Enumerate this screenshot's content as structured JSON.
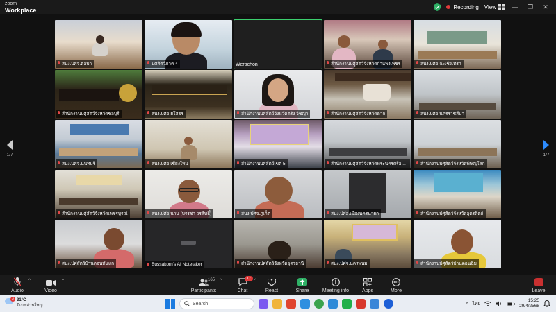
{
  "window": {
    "brand_top": "zoom",
    "brand_bottom": "Workplace",
    "recording_label": "Recording",
    "view_label": "View",
    "view_icon": "grid-icon",
    "controls": [
      "minimize",
      "maximize",
      "close"
    ]
  },
  "gallery": {
    "page_left": "1/7",
    "page_right": "1/7",
    "tiles": [
      {
        "name": "สนง.ปศจ.ตอบา",
        "plain": false
      },
      {
        "name": "ปศสัตว์ภาค 4",
        "plain": false
      },
      {
        "name": "Werachon",
        "plain": true
      },
      {
        "name": "สำนักงานปศุสัตว์จังหวัดกำแพงเพชร",
        "plain": false
      },
      {
        "name": "สนง.ปศจ.ฉะเชิงเทรา",
        "plain": false
      },
      {
        "name": "สำนักงานปศุสัตว์จังหวัดชลบุรี",
        "plain": false
      },
      {
        "name": "สนง.ปศจ.ยโสธร",
        "plain": false
      },
      {
        "name": "สำนักงานปศุสัตว์จังหวัดตรัง วิชญา",
        "plain": false
      },
      {
        "name": "สำนักงานปศุสัตว์จังหวัดตาก",
        "plain": false
      },
      {
        "name": "สนง.ปศจ.นครราชสีมา",
        "plain": false
      },
      {
        "name": "สนง.ปศจ.นนทบุรี",
        "plain": false
      },
      {
        "name": "สนง.ปศจ.เชียงใหม่",
        "plain": false
      },
      {
        "name": "สำนักงานปศุสัตว์เขต 5",
        "plain": false
      },
      {
        "name": "สำนักงานปศุสัตว์จังหวัดพระนครศรีอยุธยา",
        "plain": false
      },
      {
        "name": "สำนักงานปศุสัตว์จังหวัดพิษณุโลก",
        "plain": false
      },
      {
        "name": "สำนักงานปศุสัตว์จังหวัดเพชรบูรณ์",
        "plain": false
      },
      {
        "name": "สนง.ปศจ.นาน (บรรชา วรสิทธิ์)",
        "plain": false
      },
      {
        "name": "สนง.ปศจ.ภูเก็ต",
        "plain": false
      },
      {
        "name": "สนง.ปศอ.เมืองนครนายก",
        "plain": false
      },
      {
        "name": "สำนักงานปศุสัตว์จังหวัดอุตรดิตถ์",
        "plain": false
      },
      {
        "name": "สนง.ปศุสัตว์บ้านดอนหันแก",
        "plain": false
      },
      {
        "name": "Bussakorn's AI Notetaker",
        "plain": false
      },
      {
        "name": "สำนักงานปศุสัตว์จังหวัดอุดรธานี",
        "plain": false
      },
      {
        "name": "สนง.ปศจ.นครพนม",
        "plain": false
      },
      {
        "name": "สำนักงานปศุสัตว์บ้านดอนฉิม",
        "plain": false
      }
    ]
  },
  "toolbar": {
    "audio": "Audio",
    "video": "Video",
    "participants": "Participants",
    "participants_count": "165",
    "chat": "Chat",
    "chat_badge": "17",
    "react": "React",
    "share": "Share",
    "meeting_info": "Meeting info",
    "apps": "Apps",
    "more": "More",
    "leave": "Leave"
  },
  "taskbar": {
    "weather_temp": "31°C",
    "weather_desc": "มีเมฆส่วนใหญ่",
    "weather_badge": "3",
    "search_placeholder": "Search",
    "lang": "ไทย",
    "time": "15:25",
    "date": "29/4/2568"
  },
  "colors": {
    "active_speaker": "#3ccf6e",
    "share_green": "#2fb166",
    "leave_red": "#c93030",
    "nav_blue": "#2d8cff"
  }
}
